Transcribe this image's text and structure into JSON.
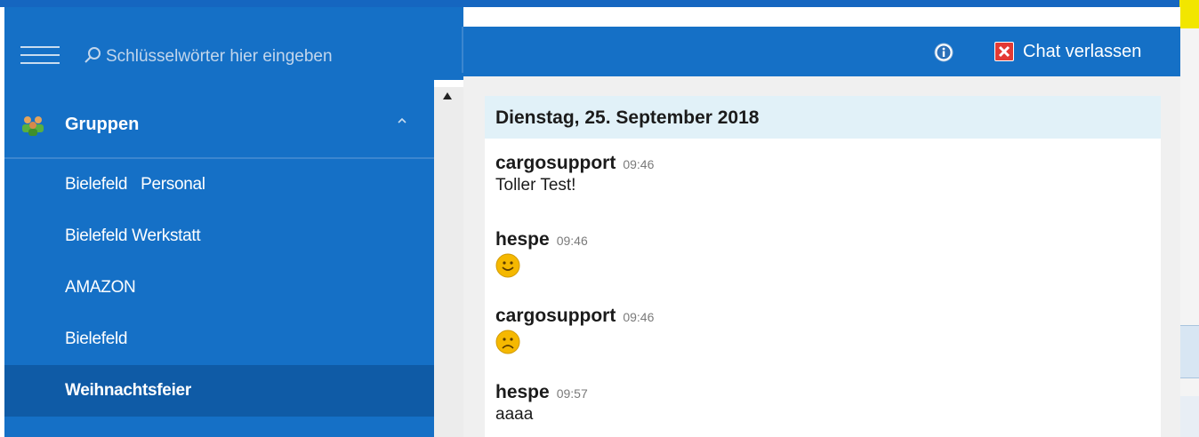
{
  "search": {
    "placeholder": "Schlüsselwörter hier eingeben"
  },
  "sidebar": {
    "section_label": "Gruppen",
    "items": [
      {
        "label": "Bielefeld   Personal"
      },
      {
        "label": "Bielefeld Werkstatt"
      },
      {
        "label": "AMAZON"
      },
      {
        "label": "Bielefeld"
      },
      {
        "label": "Weihnachtsfeier",
        "selected": true
      }
    ]
  },
  "header": {
    "leave_label": "Chat verlassen"
  },
  "chat": {
    "date": "Dienstag, 25. September 2018",
    "messages": [
      {
        "author": "cargosupport",
        "time": "09:46",
        "text": "Toller Test!"
      },
      {
        "author": "hespe",
        "time": "09:46",
        "emoji": "smile-emoji"
      },
      {
        "author": "cargosupport",
        "time": "09:46",
        "emoji": "frown-emoji"
      },
      {
        "author": "hespe",
        "time": "09:57",
        "text": "aaaa"
      }
    ]
  },
  "colors": {
    "sidebar_bg": "#1570c6",
    "selected_bg": "#0f5ba6",
    "date_bg": "#e1f1f8",
    "leave_icon": "#e43a34",
    "emoji": "#f5b800"
  }
}
